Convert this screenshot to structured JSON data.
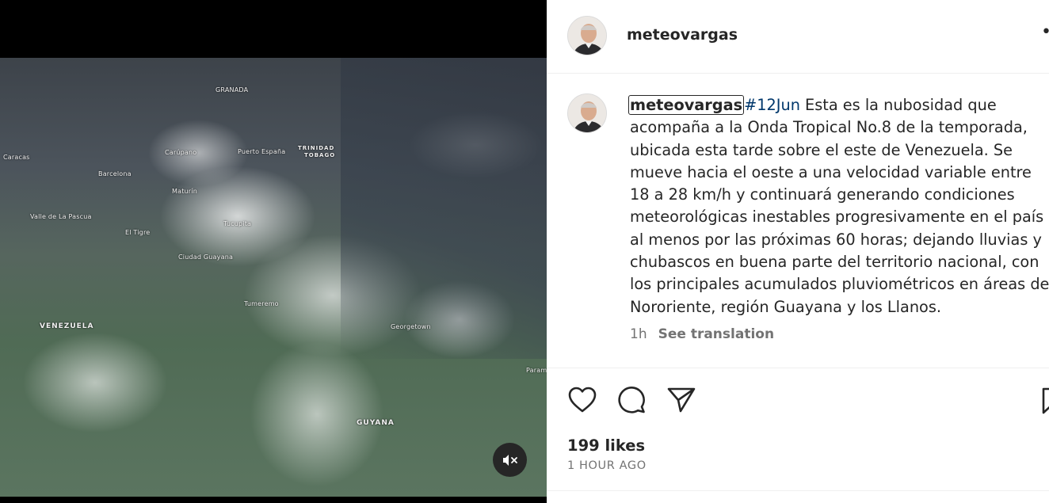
{
  "post": {
    "username": "meteovargas",
    "more_icon": "more-options-icon"
  },
  "media": {
    "map_labels": {
      "granada": "GRANADA",
      "caracas": "Caracas",
      "barcelona": "Barcelona",
      "carupano": "Carúpano",
      "puerto_espana": "Puerto España",
      "trinidad": "TRINIDAD",
      "tobago": "TOBAGO",
      "maturin": "Maturín",
      "valle_pascua": "Valle de La Pascua",
      "el_tigre": "El Tigre",
      "tucupita": "Tucupita",
      "ciudad_guayana": "Ciudad Guayana",
      "venezuela": "VENEZUELA",
      "tumeremo": "Tumeremo",
      "georgetown": "Georgetown",
      "paramaribo": "Param",
      "guyana": "GUYANA"
    },
    "mute_icon": "speaker-muted-icon"
  },
  "caption": {
    "username": "meteovargas",
    "hashtag": "#12Jun",
    "text": " Esta es la nubosidad que acompaña a la Onda Tropical No.8 de la temporada, ubicada esta tarde sobre el este de Venezuela. Se mueve hacia el oeste a una velocidad variable entre 18 a 28 km/h y continuará generando condiciones meteorológicas inestables progresivamente en el país al menos por las próximas 60 horas; dejando lluvias y chubascos en buena parte del territorio nacional, con los principales acumulados pluviométricos en áreas de Nororiente, región Guayana y los Llanos.",
    "age": "1h",
    "see_translation": "See translation"
  },
  "actions": {
    "like_icon": "heart-icon",
    "comment_icon": "comment-icon",
    "share_icon": "share-icon",
    "save_icon": "bookmark-icon"
  },
  "stats": {
    "likes": "199 likes",
    "time_ago": "1 HOUR AGO"
  }
}
